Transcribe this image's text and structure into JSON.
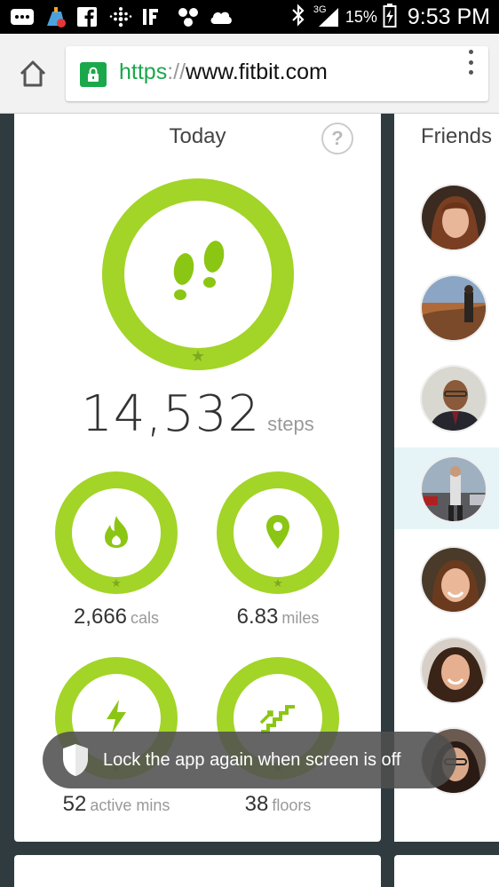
{
  "status_bar": {
    "network": "3G",
    "battery_percent": "15%",
    "time": "9:53 PM",
    "icons": [
      "messenger-icon",
      "cleaner-icon",
      "facebook-icon",
      "fitbit-icon",
      "ifttt-icon",
      "pinwheel-icon",
      "cloud-icon",
      "bluetooth-icon",
      "signal-icon",
      "battery-icon"
    ]
  },
  "browser": {
    "url_scheme": "https",
    "url_separator": "://",
    "url_host": "www.fitbit.com",
    "secure": true
  },
  "today": {
    "title": "Today",
    "help": "?",
    "steps": {
      "value": "14,532",
      "unit": "steps",
      "goal_met": true
    },
    "stats": [
      {
        "id": "calories",
        "value": "2,666",
        "unit": "cals",
        "icon": "flame-icon",
        "goal_met": true
      },
      {
        "id": "distance",
        "value": "6.83",
        "unit": "miles",
        "icon": "location-pin-icon",
        "goal_met": true
      },
      {
        "id": "active",
        "value": "52",
        "unit": "active mins",
        "icon": "lightning-icon",
        "goal_met": true
      },
      {
        "id": "floors",
        "value": "38",
        "unit": "floors",
        "icon": "stairs-icon",
        "goal_met": true
      }
    ]
  },
  "friends": {
    "title": "Friends",
    "count_visible": 7,
    "highlighted_index": 3
  },
  "toast": {
    "text": "Lock the app again when screen is off",
    "icon": "shield-icon"
  },
  "colors": {
    "ring": "#a3d428",
    "icon_green": "#8cc614",
    "star": "#7fa821",
    "secure_green": "#1aa84b",
    "background": "#2f3b3f"
  }
}
